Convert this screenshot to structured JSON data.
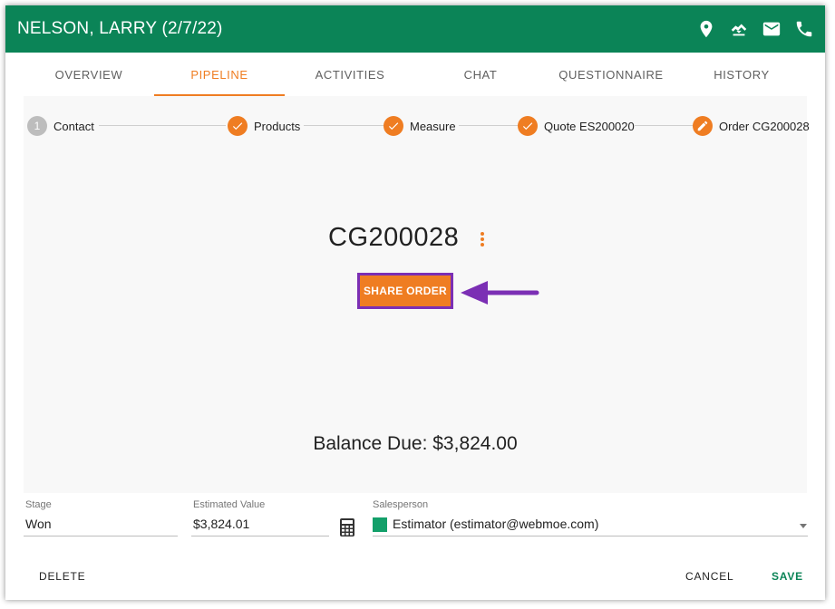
{
  "header": {
    "title": "NELSON, LARRY (2/7/22)",
    "icons": [
      "location-icon",
      "handshake-icon",
      "email-icon",
      "phone-icon"
    ]
  },
  "tabs": [
    {
      "label": "OVERVIEW"
    },
    {
      "label": "PIPELINE"
    },
    {
      "label": "ACTIVITIES"
    },
    {
      "label": "CHAT"
    },
    {
      "label": "QUESTIONNAIRE"
    },
    {
      "label": "HISTORY"
    }
  ],
  "stepper": {
    "steps": [
      {
        "number": "1",
        "label": "Contact"
      },
      {
        "label": "Products"
      },
      {
        "label": "Measure"
      },
      {
        "label": "Quote ES200020"
      },
      {
        "label": "Order CG200028"
      }
    ]
  },
  "order": {
    "number": "CG200028",
    "share_label": "SHARE ORDER",
    "balance": "Balance Due: $3,824.00"
  },
  "fields": {
    "stage_label": "Stage",
    "stage_value": "Won",
    "estimated_label": "Estimated Value",
    "estimated_value": "$3,824.01",
    "salesperson_label": "Salesperson",
    "salesperson_value": "Estimator (estimator@webmoe.com)"
  },
  "footer": {
    "delete_label": "DELETE",
    "cancel_label": "CANCEL",
    "save_label": "SAVE"
  },
  "colors": {
    "brand_green": "#0b8457",
    "accent_orange": "#ef7d22",
    "highlight_purple": "#7b2fb4",
    "salesperson_swatch": "#13a06a"
  }
}
